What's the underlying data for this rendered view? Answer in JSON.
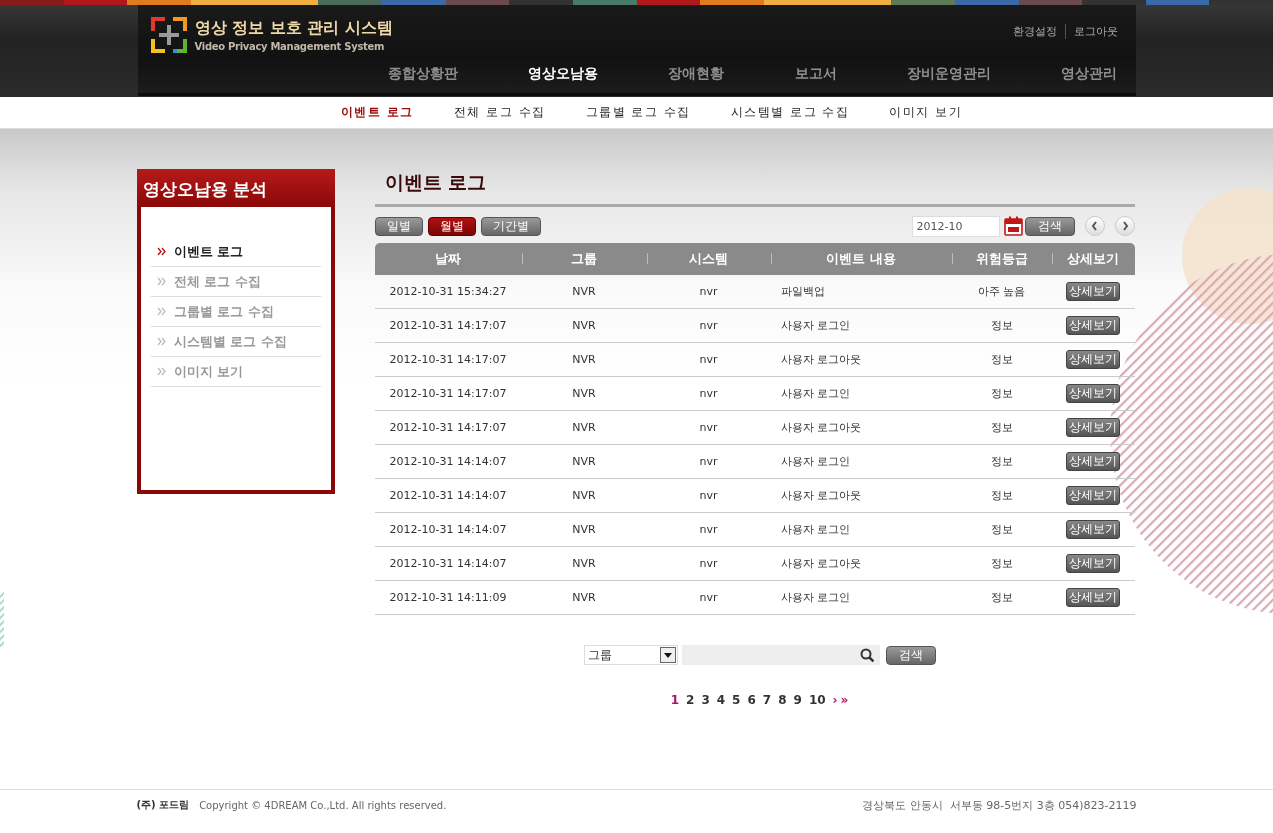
{
  "header": {
    "logo_title": "영상 정보 보호 관리 시스템",
    "logo_subtitle": "Video Privacy Management System",
    "util_links": [
      "환경설정",
      "로그아웃"
    ],
    "nav": [
      {
        "label": "종합상황판",
        "selected": false
      },
      {
        "label": "영상오남용",
        "selected": true
      },
      {
        "label": "장애현황",
        "selected": false
      },
      {
        "label": "보고서",
        "selected": false
      },
      {
        "label": "장비운영관리",
        "selected": false
      },
      {
        "label": "영상관리",
        "selected": false
      }
    ]
  },
  "subnav": [
    {
      "label": "이벤트 로그",
      "selected": true
    },
    {
      "label": "전체 로그 수집",
      "selected": false
    },
    {
      "label": "그룹별 로그 수집",
      "selected": false
    },
    {
      "label": "시스템별 로그 수집",
      "selected": false
    },
    {
      "label": "이미지 보기",
      "selected": false
    }
  ],
  "sidebar": {
    "title": "영상오남용 분석",
    "items": [
      {
        "label": "이벤트 로그",
        "selected": true
      },
      {
        "label": "전체 로그 수집",
        "selected": false
      },
      {
        "label": "그룹별 로그 수집",
        "selected": false
      },
      {
        "label": "시스템별 로그 수집",
        "selected": false
      },
      {
        "label": "이미지 보기",
        "selected": false
      }
    ]
  },
  "page_title": "이벤트 로그",
  "period_tabs": [
    {
      "label": "일별",
      "selected": false
    },
    {
      "label": "월별",
      "selected": true
    },
    {
      "label": "기간별",
      "selected": false
    }
  ],
  "date_field": {
    "value": "2012-10"
  },
  "date_search_button": "검색",
  "table": {
    "columns": [
      "날짜",
      "그룹",
      "시스템",
      "이벤트 내용",
      "위험등급",
      "상세보기"
    ],
    "rows": [
      {
        "date": "2012-10-31 15:34:27",
        "group": "NVR",
        "system": "nvr",
        "event": "파일백업",
        "level": "아주 높음",
        "action": "상세보기"
      },
      {
        "date": "2012-10-31 14:17:07",
        "group": "NVR",
        "system": "nvr",
        "event": "사용자 로그인",
        "level": "정보",
        "action": "상세보기"
      },
      {
        "date": "2012-10-31 14:17:07",
        "group": "NVR",
        "system": "nvr",
        "event": "사용자 로그아웃",
        "level": "정보",
        "action": "상세보기"
      },
      {
        "date": "2012-10-31 14:17:07",
        "group": "NVR",
        "system": "nvr",
        "event": "사용자 로그인",
        "level": "정보",
        "action": "상세보기"
      },
      {
        "date": "2012-10-31 14:17:07",
        "group": "NVR",
        "system": "nvr",
        "event": "사용자 로그아웃",
        "level": "정보",
        "action": "상세보기"
      },
      {
        "date": "2012-10-31 14:14:07",
        "group": "NVR",
        "system": "nvr",
        "event": "사용자 로그인",
        "level": "정보",
        "action": "상세보기"
      },
      {
        "date": "2012-10-31 14:14:07",
        "group": "NVR",
        "system": "nvr",
        "event": "사용자 로그아웃",
        "level": "정보",
        "action": "상세보기"
      },
      {
        "date": "2012-10-31 14:14:07",
        "group": "NVR",
        "system": "nvr",
        "event": "사용자 로그인",
        "level": "정보",
        "action": "상세보기"
      },
      {
        "date": "2012-10-31 14:14:07",
        "group": "NVR",
        "system": "nvr",
        "event": "사용자 로그아웃",
        "level": "정보",
        "action": "상세보기"
      },
      {
        "date": "2012-10-31 14:11:09",
        "group": "NVR",
        "system": "nvr",
        "event": "사용자 로그인",
        "level": "정보",
        "action": "상세보기"
      }
    ]
  },
  "filter": {
    "select_value": "그룹",
    "search_button": "검색"
  },
  "pagination": {
    "pages": [
      {
        "label": "1",
        "selected": true
      },
      {
        "label": "2",
        "selected": false
      },
      {
        "label": "3",
        "selected": false
      },
      {
        "label": "4",
        "selected": false
      },
      {
        "label": "5",
        "selected": false
      },
      {
        "label": "6",
        "selected": false
      },
      {
        "label": "7",
        "selected": false
      },
      {
        "label": "8",
        "selected": false
      },
      {
        "label": "9",
        "selected": false
      },
      {
        "label": "10",
        "selected": false
      }
    ],
    "next": "›",
    "last": "»"
  },
  "footer": {
    "company": "(주) 포드림",
    "copyright": "Copyright © 4DREAM Co.,Ltd. All rights reserved.",
    "address": "경상북도 안동시  서부동 98-5번지 3층 054)823-2119"
  }
}
